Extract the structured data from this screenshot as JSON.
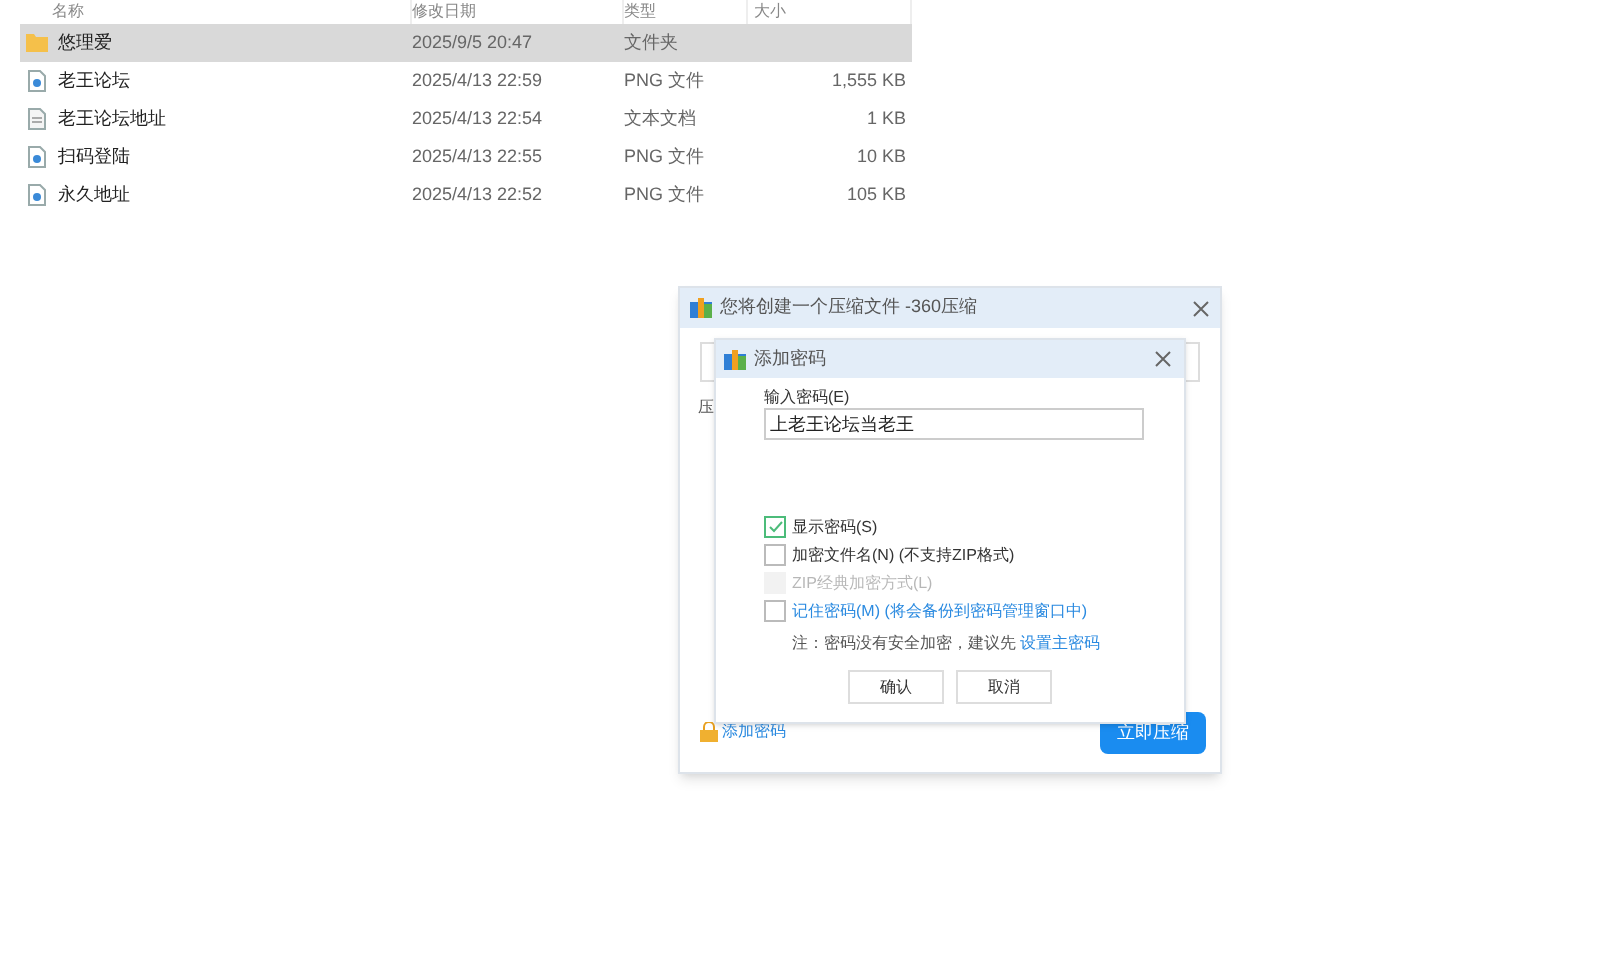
{
  "file_list": {
    "columns": [
      "名称",
      "修改日期",
      "类型",
      "大小"
    ],
    "rows": [
      {
        "kind": "folder",
        "name": "悠理爱",
        "date": "2025/9/5 20:47",
        "type": "文件夹",
        "size": "",
        "selected": true
      },
      {
        "kind": "image",
        "name": "老王论坛",
        "date": "2025/4/13 22:59",
        "type": "PNG 文件",
        "size": "1,555 KB",
        "selected": false
      },
      {
        "kind": "text",
        "name": "老王论坛地址",
        "date": "2025/4/13 22:54",
        "type": "文本文档",
        "size": "1 KB",
        "selected": false
      },
      {
        "kind": "image",
        "name": "扫码登陆",
        "date": "2025/4/13 22:55",
        "type": "PNG 文件",
        "size": "10 KB",
        "selected": false
      },
      {
        "kind": "image",
        "name": "永久地址",
        "date": "2025/4/13 22:52",
        "type": "PNG 文件",
        "size": "105 KB",
        "selected": false
      }
    ]
  },
  "compress_dialog": {
    "title": "您将创建一个压缩文件 -360压缩",
    "label": "压",
    "add_password_link": "添加密码",
    "compress_button": "立即压缩"
  },
  "password_dialog": {
    "title": "添加密码",
    "password_label": "输入密码(E)",
    "password_value": "上老王论坛当老王",
    "options": [
      {
        "label": "显示密码(S)",
        "checked": true,
        "disabled": false,
        "link": false
      },
      {
        "label": "加密文件名(N) (不支持ZIP格式)",
        "checked": false,
        "disabled": false,
        "link": false
      },
      {
        "label": "ZIP经典加密方式(L)",
        "checked": false,
        "disabled": true,
        "link": false
      },
      {
        "label": "记住密码(M) (将会备份到密码管理窗口中)",
        "checked": false,
        "disabled": false,
        "link": true
      }
    ],
    "note": "注：密码没有安全加密，建议先",
    "note_link": "设置主密码",
    "buttons": [
      "确认",
      "取消"
    ]
  }
}
